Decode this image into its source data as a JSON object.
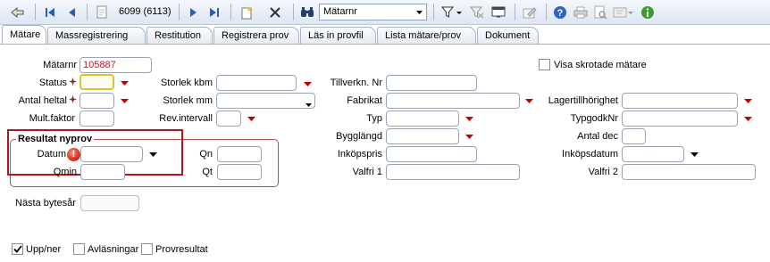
{
  "toolbar": {
    "record_counter": "6099 (6113)",
    "search_field_value": "Mätarnr",
    "icons": [
      "run-icon",
      "first-record-icon",
      "previous-record-icon",
      "document-icon",
      "next-record-icon",
      "last-record-icon",
      "new-record-icon",
      "delete-icon",
      "binoculars-icon",
      "filter-icon",
      "clear-filter-icon",
      "window-icon",
      "edit-icon",
      "help-icon",
      "print-icon",
      "preview-icon",
      "export-icon",
      "info-icon"
    ]
  },
  "tabs": [
    "Mätare",
    "Massregistrering",
    "Restitution",
    "Registrera prov",
    "Läs in provfil",
    "Lista mätare/prov",
    "Dokument"
  ],
  "form": {
    "matarnr_label": "Mätarnr",
    "matarnr_value": "105887",
    "status_label": "Status",
    "antal_heltal_label": "Antal heltal",
    "mult_faktor_label": "Mult.faktor",
    "storlek_kbm_label": "Storlek kbm",
    "storlek_mm_label": "Storlek mm",
    "rev_intervall_label": "Rev.intervall",
    "tillverkn_nr_label": "Tillverkn. Nr",
    "fabrikat_label": "Fabrikat",
    "typ_label": "Typ",
    "bygglangd_label": "Bygglängd",
    "inkopspris_label": "Inköpspris",
    "valfri1_label": "Valfri 1",
    "visa_skrotade_label": "Visa skrotade mätare",
    "lagertillhorighet_label": "Lagertillhörighet",
    "typgodknr_label": "TypgodkNr",
    "antal_dec_label": "Antal dec",
    "inkopsdatum_label": "Inköpsdatum",
    "valfri2_label": "Valfri 2",
    "resultat_title": "Resultat nyprov",
    "datum_label": "Datum",
    "qn_label": "Qn",
    "qmin_label": "Qmin",
    "qt_label": "Qt",
    "nasta_bytesar_label": "Nästa bytesår",
    "warning_mark": "!"
  },
  "footer": {
    "upp_ner_label": "Upp/ner",
    "upp_ner_checked": true,
    "avlasningar_label": "Avläsningar",
    "avlasningar_checked": false,
    "provresultat_label": "Provresultat",
    "provresultat_checked": false
  },
  "colors": {
    "dropdown_arrow": "#c00000",
    "highlight_border": "#b01821",
    "value_text": "#b11e2a"
  }
}
